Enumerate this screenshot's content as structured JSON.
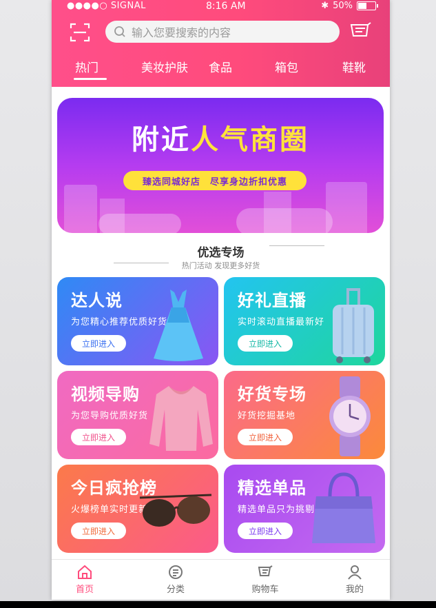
{
  "status": {
    "signal": "●●●●○ SIGNAL",
    "time": "8:16 AM",
    "battery": "50%"
  },
  "search": {
    "placeholder": "输入您要搜索的内容"
  },
  "tabs": [
    {
      "label": "热门"
    },
    {
      "label": "美妆护肤"
    },
    {
      "label": "食品"
    },
    {
      "label": "箱包"
    },
    {
      "label": "鞋靴"
    }
  ],
  "banner": {
    "title_part1": "附近",
    "title_part2": "人气商圈",
    "pill_left": "臻选同城好店",
    "pill_right": "尽享身边折扣优惠"
  },
  "section": {
    "title": "优选专场",
    "subtitle": "热门活动 发现更多好货"
  },
  "cards": [
    {
      "title": "达人说",
      "desc": "为您精心推荐优质好货",
      "button": "立即进入",
      "btn_color": "#3a6ff0"
    },
    {
      "title": "好礼直播",
      "desc": "实时滚动直播最新好",
      "button": "立即进入",
      "btn_color": "#15b8a6"
    },
    {
      "title": "视频导购",
      "desc": "为您导购优质好货",
      "button": "立即进入",
      "btn_color": "#f04f8a"
    },
    {
      "title": "好货专场",
      "desc": "好货挖掘基地",
      "button": "立即进入",
      "btn_color": "#f0603a"
    },
    {
      "title": "今日疯抢榜",
      "desc": "火爆榜单实时更新",
      "button": "立即进入",
      "btn_color": "#f06a3a"
    },
    {
      "title": "精选单品",
      "desc": "精选单品只为挑剔的你",
      "button": "立即进入",
      "btn_color": "#7b3af0"
    }
  ],
  "nav": [
    {
      "label": "首页",
      "icon": "home-icon"
    },
    {
      "label": "分类",
      "icon": "category-icon"
    },
    {
      "label": "购物车",
      "icon": "cart-icon"
    },
    {
      "label": "我的",
      "icon": "user-icon"
    }
  ],
  "colors": {
    "accent": "#ff4b7c"
  }
}
